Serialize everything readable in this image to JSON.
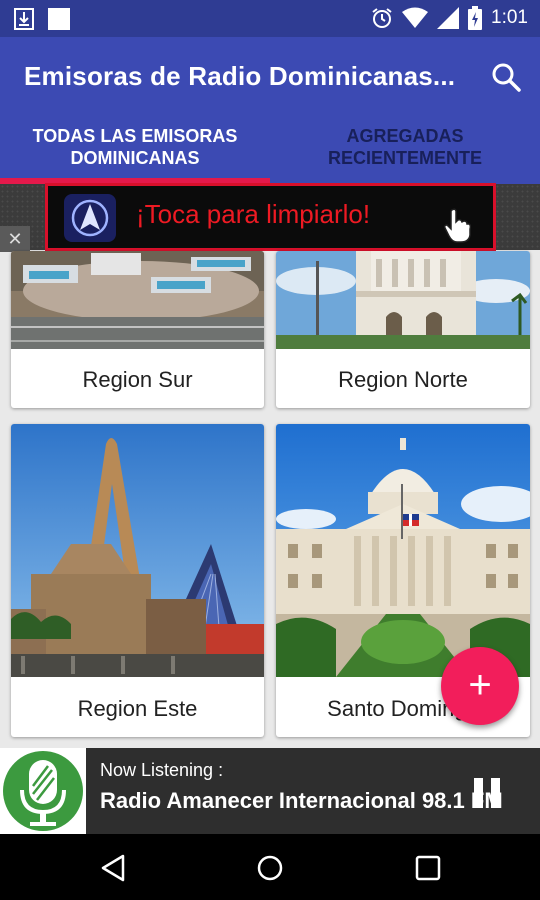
{
  "status_bar": {
    "time": "1:01",
    "icons": [
      "download-icon",
      "image-icon",
      "alarm-icon",
      "wifi-icon",
      "signal-icon",
      "battery-icon"
    ]
  },
  "app_bar": {
    "title": "Emisoras de Radio Dominicanas...",
    "search_icon": "search-icon"
  },
  "tabs": [
    {
      "line1": "TODAS LAS EMISORAS",
      "line2": "DOMINICANAS",
      "selected": true
    },
    {
      "line1": "AGREGADAS",
      "line2": "RECIENTEMENTE",
      "selected": false
    }
  ],
  "ad": {
    "text": "¡Toca para limpiarlo!",
    "close": "✕",
    "text_color": "#ee1a23",
    "border_color": "#d8102b"
  },
  "regions": [
    {
      "label": "Region Sur"
    },
    {
      "label": "Region Norte"
    },
    {
      "label": "Region Este"
    },
    {
      "label": "Santo Domingo"
    }
  ],
  "fab": {
    "label": "+",
    "color": "#f21e5b"
  },
  "player": {
    "now_label": "Now Listening :",
    "station": "Radio Amanecer Internacional 98.1 FM"
  },
  "colors": {
    "primary": "#3c4ab3",
    "primary_dark": "#2f3c93",
    "accent": "#e4194b"
  }
}
